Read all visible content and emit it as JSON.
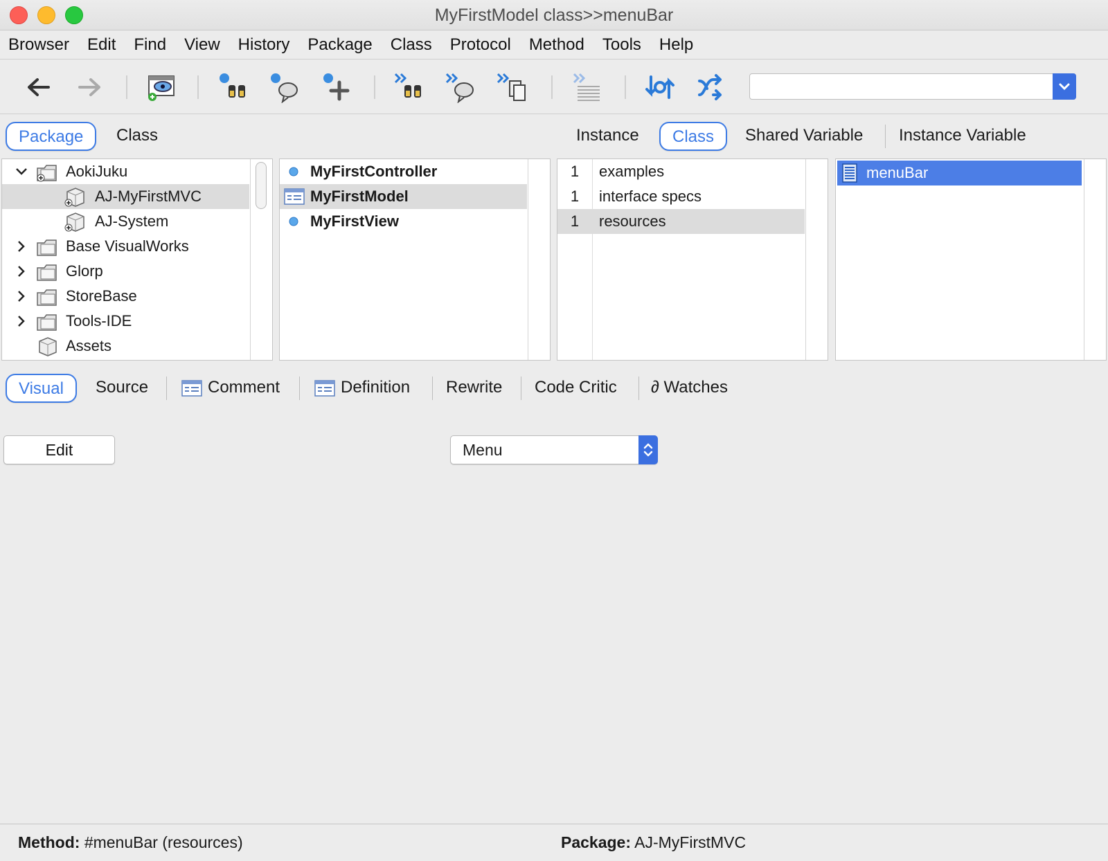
{
  "window": {
    "title": "MyFirstModel class>>menuBar"
  },
  "menubar": [
    "Browser",
    "Edit",
    "Find",
    "View",
    "History",
    "Package",
    "Class",
    "Protocol",
    "Method",
    "Tools",
    "Help"
  ],
  "toolbar": {
    "buttons": [
      "back-arrow-icon",
      "forward-arrow-icon",
      "visual-launcher-icon",
      "find-class-icon",
      "find-references-icon",
      "add-class-icon",
      "find-method-icon",
      "find-senders-icon",
      "copy-method-icon",
      "format-list-icon",
      "sync-icon",
      "shuffle-icon"
    ],
    "search_value": ""
  },
  "upper_tabs": {
    "package": "Package",
    "class": "Class",
    "instance": "Instance",
    "class_side": "Class",
    "shared_variable": "Shared Variable",
    "instance_variable": "Instance Variable"
  },
  "packages": [
    {
      "label": "AokiJuku",
      "expander": "open",
      "indent": 0
    },
    {
      "label": "AJ-MyFirstMVC",
      "expander": "none",
      "indent": 1,
      "selected": true
    },
    {
      "label": "AJ-System",
      "expander": "none",
      "indent": 1
    },
    {
      "label": "Base VisualWorks",
      "expander": "closed",
      "indent": 0
    },
    {
      "label": "Glorp",
      "expander": "closed",
      "indent": 0
    },
    {
      "label": "StoreBase",
      "expander": "closed",
      "indent": 0
    },
    {
      "label": "Tools-IDE",
      "expander": "closed",
      "indent": 0
    },
    {
      "label": "Assets",
      "expander": "none",
      "indent": 0
    }
  ],
  "classes": [
    {
      "label": "MyFirstController",
      "icon": "class-dot-icon"
    },
    {
      "label": "MyFirstModel",
      "icon": "class-window-icon",
      "selected": true
    },
    {
      "label": "MyFirstView",
      "icon": "class-dot-icon"
    }
  ],
  "protocols": [
    {
      "count": "1",
      "label": "examples"
    },
    {
      "count": "1",
      "label": "interface specs"
    },
    {
      "count": "1",
      "label": "resources",
      "selected": true
    }
  ],
  "methods": [
    {
      "label": "menuBar",
      "selected": true
    }
  ],
  "lower_tabs": {
    "visual": "Visual",
    "source": "Source",
    "comment": "Comment",
    "definition": "Definition",
    "rewrite": "Rewrite",
    "code_critic": "Code Critic",
    "watches": "∂ Watches"
  },
  "editor": {
    "edit_button": "Edit",
    "resource_type": "Menu"
  },
  "status": {
    "method_label": "Method:",
    "method_value": "#menuBar (resources)",
    "package_label": "Package:",
    "package_value": "AJ-MyFirstMVC"
  },
  "colors": {
    "accent": "#3d7be5",
    "selection_blue": "#4c7ee6",
    "selection_gray": "#dcdcdc"
  }
}
